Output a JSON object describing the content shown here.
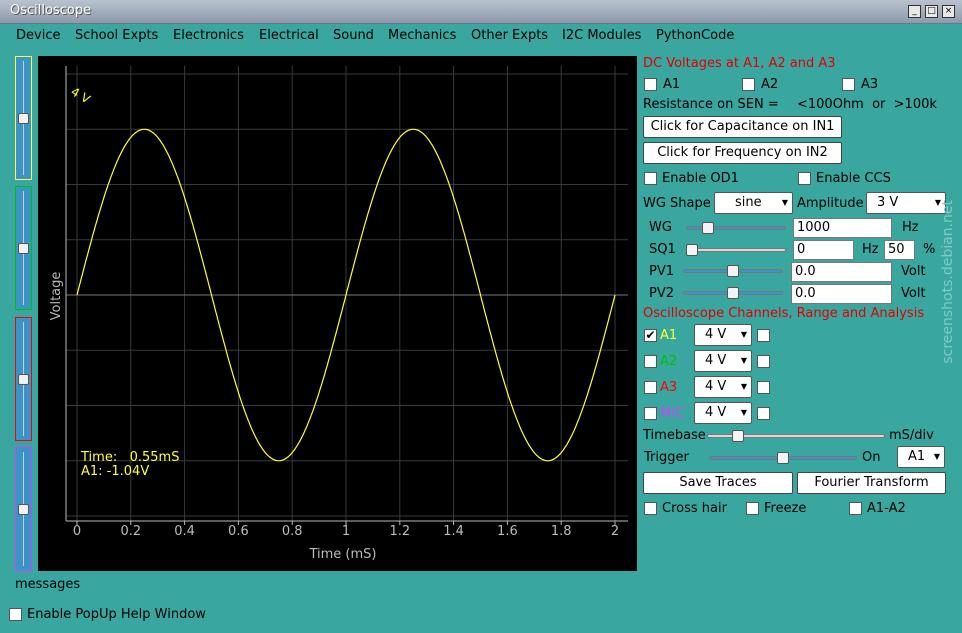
{
  "window": {
    "title": "Oscilloscope"
  },
  "menu": [
    "Device",
    "School Expts",
    "Electronics",
    "Electrical",
    "Sound",
    "Mechanics",
    "Other Expts",
    "I2C Modules",
    "PythonCode"
  ],
  "plot": {
    "range_label": "4 V",
    "ylabel": "Voltage",
    "xlabel": "Time (mS)",
    "readout_time": "Time:   0.55mS",
    "readout_a1": "A1: -1.04V",
    "trace_color": "#ffff33",
    "grid_color": "#3a3a3a"
  },
  "chart_data": {
    "type": "line",
    "xlabel": "Time (mS)",
    "ylabel": "Voltage",
    "xlim": [
      0,
      2
    ],
    "ylim": [
      -4,
      4
    ],
    "xticks": [
      "0",
      "0.2",
      "0.4",
      "0.6",
      "0.8",
      "1",
      "1.2",
      "1.4",
      "1.6",
      "1.8",
      "2"
    ],
    "series": [
      {
        "name": "A1",
        "color": "#ffff33",
        "frequency_hz": 1000,
        "amplitude_v": 3,
        "shape": "sine"
      }
    ]
  },
  "dc": {
    "heading": "DC Voltages at A1, A2 and A3",
    "a1": "A1",
    "a2": "A2",
    "a3": "A3"
  },
  "resistance": {
    "label": "Resistance on SEN =",
    "value": "<100Ohm  or  >100k"
  },
  "buttons": {
    "capacitance": "Click for Capacitance on IN1",
    "frequency": "Click for Frequency on IN2",
    "save": "Save Traces",
    "fourier": "Fourier Transform"
  },
  "toggles": {
    "od1": "Enable OD1",
    "ccs": "Enable CCS",
    "crosshair": "Cross hair",
    "freeze": "Freeze",
    "a1a2": "A1-A2"
  },
  "wg": {
    "shape_label": "WG Shape",
    "shape": "sine",
    "amplitude_label": "Amplitude",
    "amplitude": "3 V",
    "label": "WG",
    "value": "1000",
    "unit": "Hz",
    "level": 0.18
  },
  "sq1": {
    "label": "SQ1",
    "value": "0",
    "unit": "Hz",
    "duty": "50",
    "duty_unit": "%",
    "level": 0.0
  },
  "pv1": {
    "label": "PV1",
    "value": "0.0",
    "unit": "Volt",
    "level": 0.5
  },
  "pv2": {
    "label": "PV2",
    "value": "0.0",
    "unit": "Volt",
    "level": 0.5
  },
  "channels": {
    "heading": "Oscilloscope Channels, Range and Analysis",
    "items": [
      {
        "name": "A1",
        "range": "4 V",
        "color": "#ffff33",
        "checked": true
      },
      {
        "name": "A2",
        "range": "4 V",
        "color": "#00c000",
        "checked": false
      },
      {
        "name": "A3",
        "range": "4 V",
        "color": "#ff0000",
        "checked": false
      },
      {
        "name": "MIC",
        "range": "4 V",
        "color": "#cc44ff",
        "checked": false
      }
    ]
  },
  "timebase": {
    "label": "Timebase",
    "unit": "mS/div",
    "level": 0.15
  },
  "trigger": {
    "label": "Trigger",
    "state": "On",
    "source": "A1",
    "level": 0.5
  },
  "messages": {
    "label": "messages"
  },
  "popup": {
    "label": "Enable PopUp Help Window"
  },
  "watermark": "screenshots.debian.net"
}
